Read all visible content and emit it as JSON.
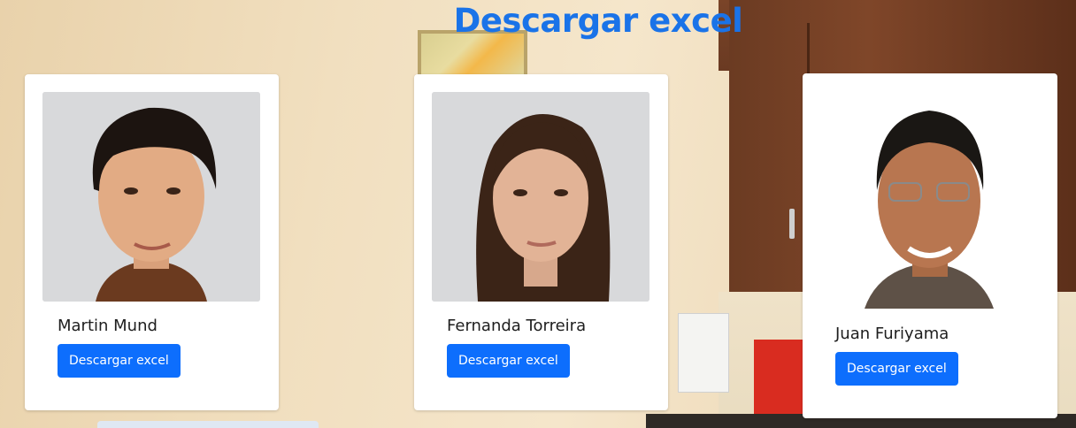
{
  "header": {
    "title": "Descargar excel"
  },
  "cards": [
    {
      "name": "Martin Mund",
      "button_label": "Descargar excel",
      "photo": "portrait-young-man-curly-dark-hair"
    },
    {
      "name": "Fernanda Torreira",
      "button_label": "Descargar excel",
      "photo": "portrait-woman-long-brown-hair"
    },
    {
      "name": "Juan Furiyama",
      "button_label": "Descargar excel",
      "photo": "portrait-man-glasses-smiling"
    }
  ],
  "colors": {
    "title": "#1a73e8",
    "button": "#0d6efd",
    "card_bg": "#ffffff"
  }
}
